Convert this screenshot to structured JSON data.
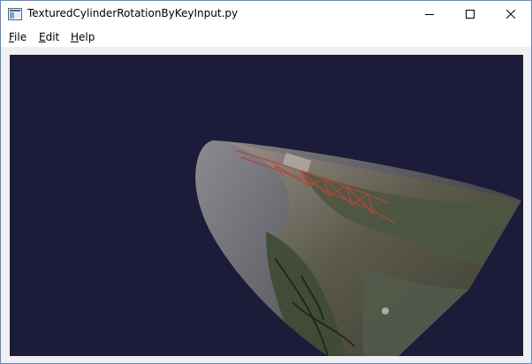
{
  "window": {
    "title": "TexturedCylinderRotationByKeyInput.py",
    "controls": {
      "minimize": "minimize-icon",
      "maximize": "maximize-icon",
      "close": "close-icon"
    }
  },
  "menu": [
    {
      "first": "F",
      "rest": "ile"
    },
    {
      "first": "E",
      "rest": "dit"
    },
    {
      "first": "H",
      "rest": "elp"
    }
  ],
  "viewport": {
    "background": "#1c1b3a",
    "object": "textured-cylinder"
  }
}
